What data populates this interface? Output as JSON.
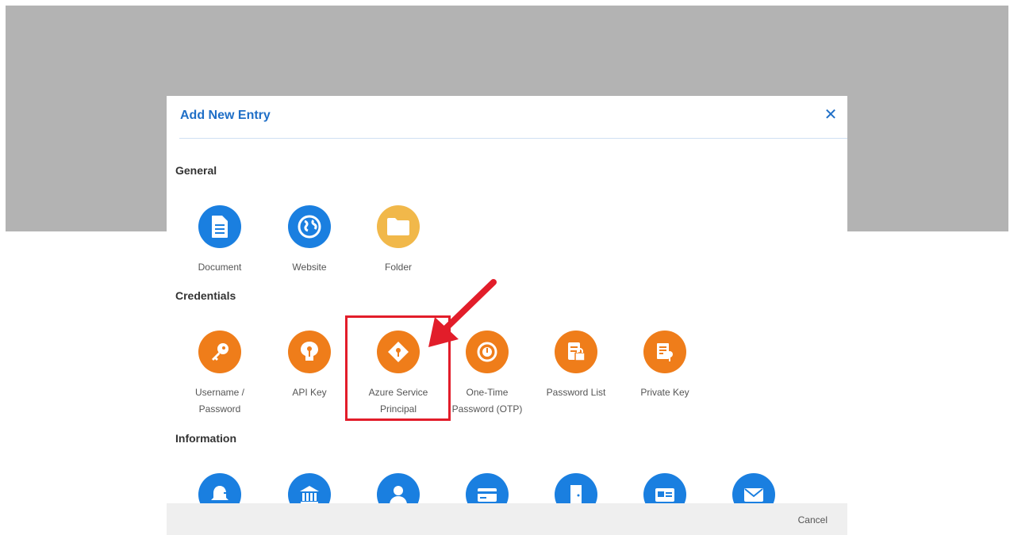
{
  "dialog": {
    "title": "Add New Entry",
    "close_symbol": "✕",
    "cancel_label": "Cancel"
  },
  "sections": {
    "general": {
      "title": "General",
      "items": [
        {
          "label": "Document",
          "icon": "document-icon",
          "color": "#1a7fe0"
        },
        {
          "label": "Website",
          "icon": "globe-icon",
          "color": "#1a7fe0"
        },
        {
          "label": "Folder",
          "icon": "folder-icon",
          "color": "#f1b84a"
        }
      ]
    },
    "credentials": {
      "title": "Credentials",
      "items": [
        {
          "label_line1": "Username /",
          "label_line2": "Password",
          "icon": "key-icon",
          "color": "#ef7d1a"
        },
        {
          "label_line1": "API Key",
          "label_line2": "",
          "icon": "api-key-icon",
          "color": "#ef7d1a"
        },
        {
          "label_line1": "Azure Service",
          "label_line2": "Principal",
          "icon": "azure-service-principal-icon",
          "color": "#ef7d1a"
        },
        {
          "label_line1": "One-Time",
          "label_line2": "Password (OTP)",
          "icon": "otp-clock-icon",
          "color": "#ef7d1a"
        },
        {
          "label_line1": "Password List",
          "label_line2": "",
          "icon": "password-list-icon",
          "color": "#ef7d1a"
        },
        {
          "label_line1": "Private Key",
          "label_line2": "",
          "icon": "private-key-icon",
          "color": "#ef7d1a"
        }
      ]
    },
    "information": {
      "title": "Information",
      "items": [
        {
          "icon": "alarm-icon",
          "color": "#1a7fe0"
        },
        {
          "icon": "bank-icon",
          "color": "#1a7fe0"
        },
        {
          "icon": "person-icon",
          "color": "#1a7fe0"
        },
        {
          "icon": "credit-card-icon",
          "color": "#1a7fe0"
        },
        {
          "icon": "door-icon",
          "color": "#1a7fe0"
        },
        {
          "icon": "id-card-icon",
          "color": "#1a7fe0"
        },
        {
          "icon": "mail-icon",
          "color": "#1a7fe0"
        }
      ]
    }
  },
  "annotation": {
    "highlight_color": "#e21d2a",
    "highlighted_item": "Azure Service Principal"
  }
}
